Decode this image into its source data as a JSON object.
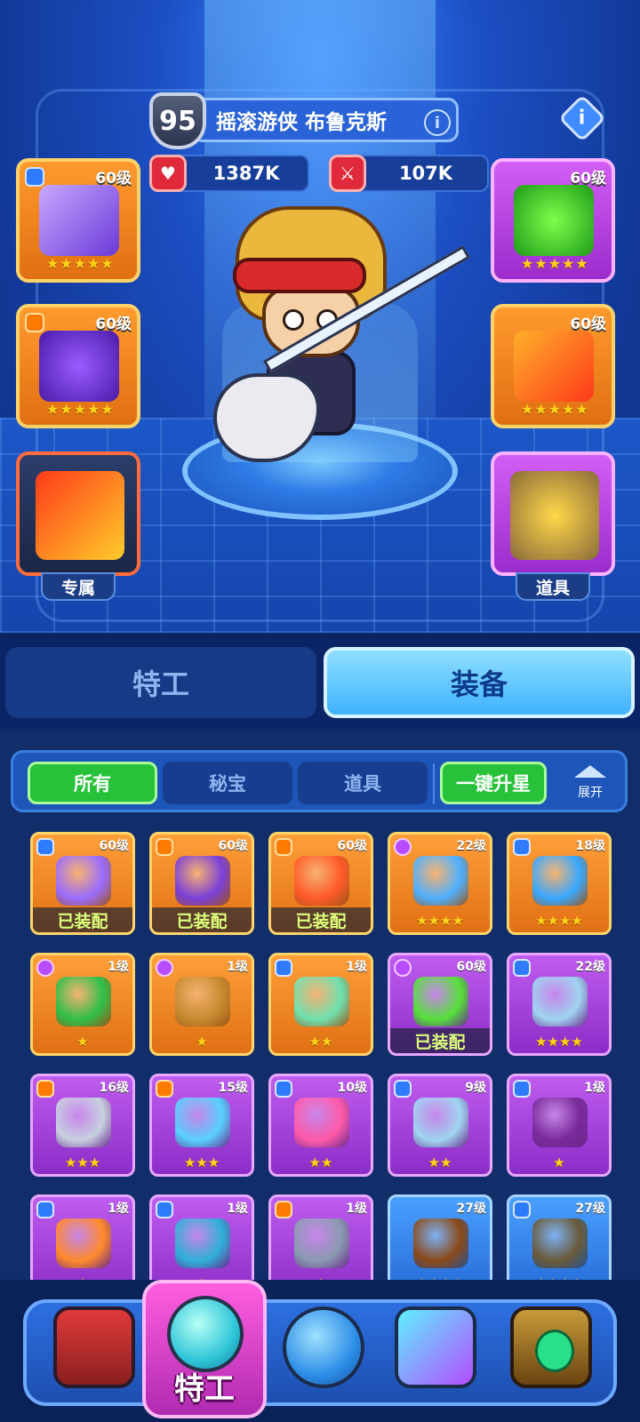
{
  "hero": {
    "level": "95",
    "name": "摇滚游侠 布鲁克斯",
    "info_icon": "i",
    "hp": "1387K",
    "attack": "107K"
  },
  "slots": {
    "left": [
      {
        "level": "60级",
        "stars": "★★★★★",
        "rarity": "orange"
      },
      {
        "level": "60级",
        "stars": "★★★★★",
        "rarity": "orange"
      },
      {
        "label": "专属",
        "rarity": "dark"
      }
    ],
    "right": [
      {
        "level": "60级",
        "stars": "★★★★★",
        "rarity": "purple"
      },
      {
        "level": "60级",
        "stars": "★★★★★",
        "rarity": "orange"
      },
      {
        "label": "道具",
        "rarity": "purple"
      }
    ]
  },
  "tabs": {
    "agent": "特工",
    "equipment": "装备",
    "active": "equipment"
  },
  "filters": {
    "all": "所有",
    "secret": "秘宝",
    "item": "道具",
    "star_up": "一键升星",
    "expand": "展开",
    "active": "all"
  },
  "equipped_label": "已装配",
  "inventory": [
    {
      "level": "60级",
      "rarity": "orange",
      "badge": "shield",
      "stars": "★★★★★",
      "equipped": true,
      "art": "#9a6cff"
    },
    {
      "level": "60级",
      "rarity": "orange",
      "badge": "crown",
      "stars": "★★★★★",
      "equipped": true,
      "art": "#7b3fd8"
    },
    {
      "level": "60级",
      "rarity": "orange",
      "badge": "crown",
      "stars": "★★★★★",
      "equipped": true,
      "art": "#ff5a2a"
    },
    {
      "level": "22级",
      "rarity": "orange",
      "badge": "gem",
      "stars": "★★★★",
      "equipped": false,
      "art": "#4fb0ff"
    },
    {
      "level": "18级",
      "rarity": "orange",
      "badge": "shield",
      "stars": "★★★★",
      "equipped": false,
      "art": "#39a8ff"
    },
    {
      "level": "1级",
      "rarity": "orange",
      "badge": "gem",
      "stars": "★",
      "equipped": false,
      "art": "#2fbf4a"
    },
    {
      "level": "1级",
      "rarity": "orange",
      "badge": "gem",
      "stars": "★",
      "equipped": false,
      "art": "#c88a30"
    },
    {
      "level": "1级",
      "rarity": "orange",
      "badge": "shield",
      "stars": "★★",
      "equipped": false,
      "art": "#6fe0b0"
    },
    {
      "level": "60级",
      "rarity": "purple",
      "badge": "gem",
      "stars": "★★★★★",
      "equipped": true,
      "art": "#56e03a"
    },
    {
      "level": "22级",
      "rarity": "purple",
      "badge": "shield",
      "stars": "★★★★",
      "equipped": false,
      "art": "#9fd4f0"
    },
    {
      "level": "16级",
      "rarity": "purple",
      "badge": "crown",
      "stars": "★★★",
      "equipped": false,
      "art": "#c8d0e0"
    },
    {
      "level": "15级",
      "rarity": "purple",
      "badge": "crown",
      "stars": "★★★",
      "equipped": false,
      "art": "#58d0ff"
    },
    {
      "level": "10级",
      "rarity": "purple",
      "badge": "shield",
      "stars": "★★",
      "equipped": false,
      "art": "#ff5aa8"
    },
    {
      "level": "9级",
      "rarity": "purple",
      "badge": "shield",
      "stars": "★★",
      "equipped": false,
      "art": "#9fd4f0"
    },
    {
      "level": "1级",
      "rarity": "purple",
      "badge": "shield",
      "stars": "★",
      "equipped": false,
      "art": "#7a2a9a"
    },
    {
      "level": "1级",
      "rarity": "purple",
      "badge": "shield",
      "stars": "★",
      "equipped": false,
      "art": "#ff8a2a"
    },
    {
      "level": "1级",
      "rarity": "purple",
      "badge": "shield",
      "stars": "★",
      "equipped": false,
      "art": "#2fb0d8"
    },
    {
      "level": "1级",
      "rarity": "purple",
      "badge": "crown",
      "stars": "★",
      "equipped": false,
      "art": "#8a9ab0"
    },
    {
      "level": "27级",
      "rarity": "blue",
      "badge": "",
      "stars": "★★★★",
      "equipped": false,
      "art": "#8a4a1a"
    },
    {
      "level": "27级",
      "rarity": "blue",
      "badge": "shield",
      "stars": "★★★★",
      "equipped": false,
      "art": "#6a5a3a"
    }
  ],
  "nav": {
    "shop_icon": "shop-machine-icon",
    "agent_label": "特工",
    "planet_icon": "planet-icon",
    "cube_icon": "cube-icon",
    "card_icon": "emerald-card-icon"
  },
  "colors": {
    "accent": "#3fb2ff",
    "filter_active": "#27c23a",
    "equipped_text": "#dcff7a"
  }
}
